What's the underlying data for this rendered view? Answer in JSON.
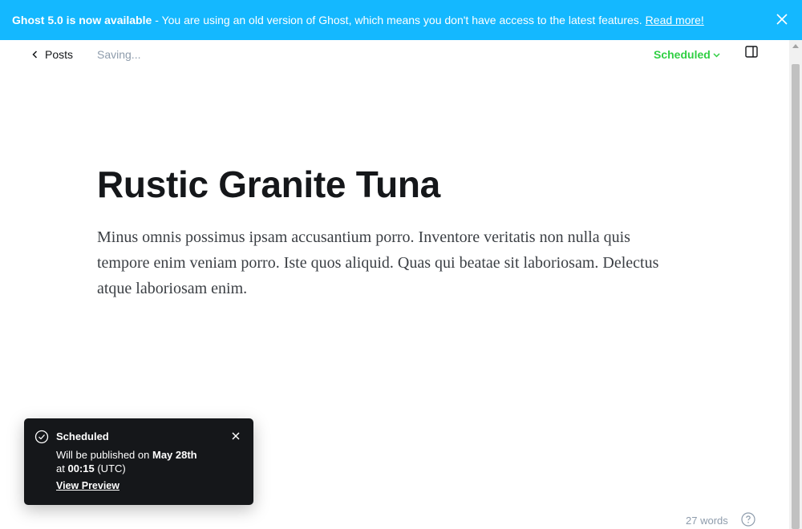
{
  "banner": {
    "strong": "Ghost 5.0 is now available",
    "message": "- You are using an old version of Ghost, which means you don't have access to the latest features.",
    "link": "Read more!",
    "close_icon": "close-icon"
  },
  "header": {
    "back_label": "Posts",
    "status": "Saving...",
    "publish_state": "Scheduled",
    "accent_color": "#30cf43"
  },
  "post": {
    "title": "Rustic Granite Tuna",
    "body": "Minus omnis possimus ipsam accusantium porro. Inventore veritatis non nulla quis tempore enim veniam porro. Iste quos aliquid. Quas qui beatae sit laboriosam. Delectus atque laboriosam enim."
  },
  "toast": {
    "title": "Scheduled",
    "line1_prefix": "Will be published on",
    "date": "May 28th",
    "line2_prefix": "at",
    "time": "00:15",
    "timezone": "(UTC)",
    "link": "View Preview"
  },
  "footer": {
    "word_count": "27 words"
  },
  "colors": {
    "banner_bg": "#14b8ff",
    "toast_bg": "#15171a"
  }
}
